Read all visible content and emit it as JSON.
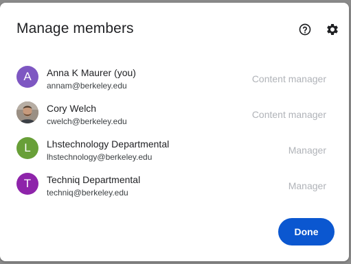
{
  "dialog": {
    "title": "Manage members",
    "done_label": "Done"
  },
  "header_icons": {
    "help": "help-circle-icon",
    "settings": "gear-icon"
  },
  "colors": {
    "primary_button": "#0b57d0",
    "role_text": "#b0b3b8"
  },
  "members": [
    {
      "name": "Anna K Maurer (you)",
      "email": "annam@berkeley.edu",
      "role": "Content manager",
      "avatar_letter": "A",
      "avatar_color": "#7e57c2"
    },
    {
      "name": "Cory Welch",
      "email": "cwelch@berkeley.edu",
      "role": "Content manager",
      "avatar_letter": "",
      "avatar_color": "#6d5a4a"
    },
    {
      "name": "Lhstechnology Departmental",
      "email": "lhstechnology@berkeley.edu",
      "role": "Manager",
      "avatar_letter": "L",
      "avatar_color": "#689f38"
    },
    {
      "name": "Techniq Departmental",
      "email": "techniq@berkeley.edu",
      "role": "Manager",
      "avatar_letter": "T",
      "avatar_color": "#8e24aa"
    }
  ]
}
